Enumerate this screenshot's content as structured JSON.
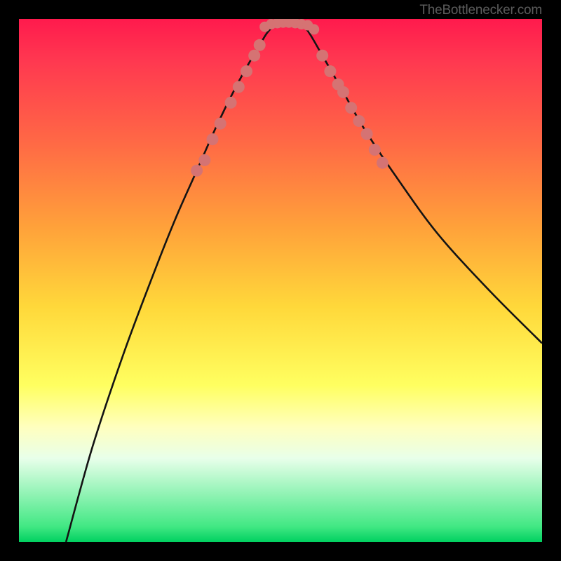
{
  "watermark": "TheBottlenecker.com",
  "chart_data": {
    "type": "line",
    "title": "",
    "xlabel": "",
    "ylabel": "",
    "ylim": [
      0,
      100
    ],
    "xlim": [
      0,
      100
    ],
    "series": [
      {
        "name": "curve",
        "x": [
          9,
          14,
          20,
          26,
          30,
          34,
          38,
          42,
          46,
          48,
          50,
          53,
          55,
          58,
          62,
          66,
          72,
          80,
          90,
          100
        ],
        "values": [
          0,
          18,
          36,
          52,
          62,
          71,
          80,
          88,
          95,
          98,
          99,
          99,
          98,
          93,
          86,
          79,
          70,
          59,
          48,
          38
        ]
      }
    ],
    "dot_clusters": {
      "left": [
        [
          34,
          71
        ],
        [
          35.5,
          73
        ],
        [
          37,
          77
        ],
        [
          38.5,
          80
        ],
        [
          40.5,
          84
        ],
        [
          42,
          87
        ],
        [
          43.5,
          90
        ],
        [
          45,
          93
        ],
        [
          46,
          95
        ]
      ],
      "right": [
        [
          58,
          93
        ],
        [
          59.5,
          90
        ],
        [
          61,
          87.5
        ],
        [
          62,
          86
        ],
        [
          63.5,
          83
        ],
        [
          65,
          80.5
        ],
        [
          66.5,
          78
        ],
        [
          68,
          75
        ],
        [
          69.5,
          72.5
        ]
      ],
      "bottom": [
        [
          47,
          98.5
        ],
        [
          48.2,
          99
        ],
        [
          49.4,
          99.2
        ],
        [
          50.5,
          99.3
        ],
        [
          51.6,
          99.3
        ],
        [
          52.8,
          99.2
        ],
        [
          54,
          99
        ],
        [
          55.2,
          98.8
        ],
        [
          56.4,
          98
        ]
      ]
    },
    "colors": {
      "curve": "#141414",
      "dots": "#d57373"
    }
  }
}
